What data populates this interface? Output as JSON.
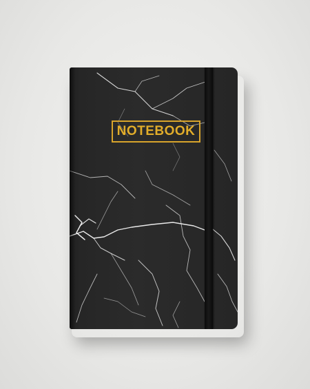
{
  "product": {
    "cover_title": "NOTEBOOK"
  },
  "colors": {
    "background": "#e9e9e7",
    "cover": "#2a2a2a",
    "veins": "#ffffff",
    "title_gold": "#e2ad2a",
    "elastic_band": "#111111"
  },
  "icons": {
    "pattern": "black-marble-texture"
  }
}
